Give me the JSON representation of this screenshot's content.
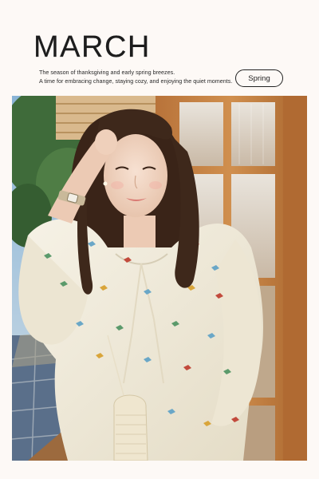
{
  "header": {
    "title": "MARCH",
    "line1": "The season of thanksgiving and early spring breezes.",
    "line2": "A time for embracing change, staying cozy, and enjoying the quiet moments.",
    "season_label": "Spring"
  },
  "colors": {
    "background": "#fdf9f6",
    "text": "#1d1d1d",
    "wood_frame": "#c9823f",
    "blouse": "#f1ecdc",
    "hair": "#3a2418"
  },
  "photo": {
    "description_icon": "portrait-photo"
  }
}
